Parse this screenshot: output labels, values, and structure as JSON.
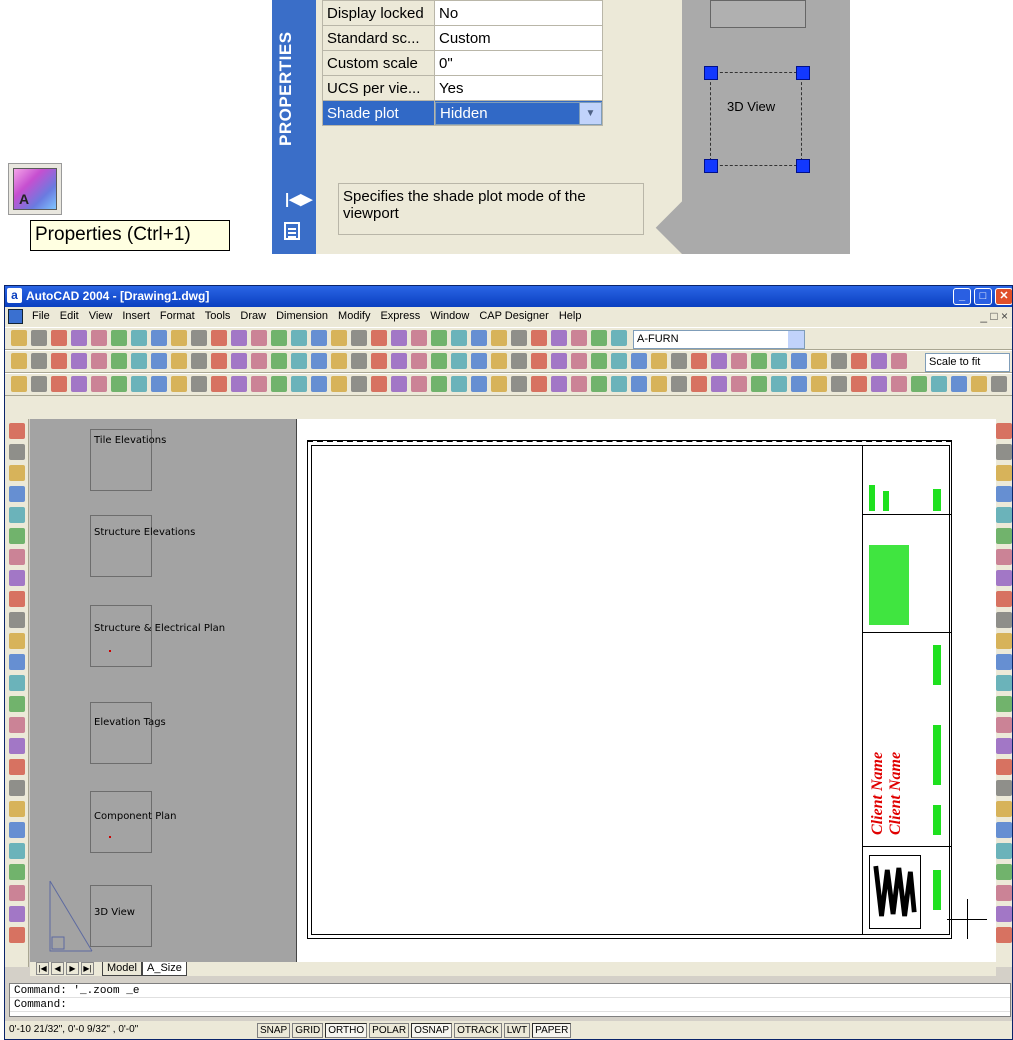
{
  "tooltip": {
    "text": "Properties (Ctrl+1)"
  },
  "properties_icon": {
    "glyph": "A",
    "icon": "properties-icon"
  },
  "palette": {
    "strip_title": "PROPERTIES",
    "rows": [
      {
        "key": "Display locked",
        "value": "No"
      },
      {
        "key": "Standard sc...",
        "value": "Custom"
      },
      {
        "key": "Custom scale",
        "value": "0\""
      },
      {
        "key": "UCS per vie...",
        "value": "Yes"
      }
    ],
    "selected_row": {
      "key": "Shade plot",
      "value": "Hidden"
    },
    "description": "Specifies the shade plot mode of the viewport",
    "viewport_label": "3D View"
  },
  "window": {
    "title": "AutoCAD 2004 - [Drawing1.dwg]",
    "app_icon": "a",
    "menu": [
      "File",
      "Edit",
      "View",
      "Insert",
      "Format",
      "Tools",
      "Draw",
      "Dimension",
      "Modify",
      "Express",
      "Window",
      "CAP Designer",
      "Help"
    ],
    "layer": "A-FURN",
    "scale": "Scale to fit"
  },
  "tiles": [
    "Tile Elevations",
    "Structure Elevations",
    "Structure & Electrical Plan",
    "Elevation Tags",
    "Component Plan",
    "3D View"
  ],
  "title_block": {
    "client_line1": "Client Name",
    "client_line2": "Client Name"
  },
  "layout_tabs": [
    "Model",
    "A_Size"
  ],
  "command": {
    "line1": "Command: '_.zoom _e",
    "line2": "Command:"
  },
  "status": {
    "coords": "0'-10 21/32\", 0'-0 9/32\" , 0'-0\"",
    "toggles": [
      "SNAP",
      "GRID",
      "ORTHO",
      "POLAR",
      "OSNAP",
      "OTRACK",
      "LWT",
      "PAPER"
    ]
  },
  "colors": {
    "accent": "#3169c6",
    "title_blue": "#0a3fc0",
    "grip_blue": "#1238ff",
    "client_red": "#e00000",
    "bar_green": "#1fe11f"
  }
}
